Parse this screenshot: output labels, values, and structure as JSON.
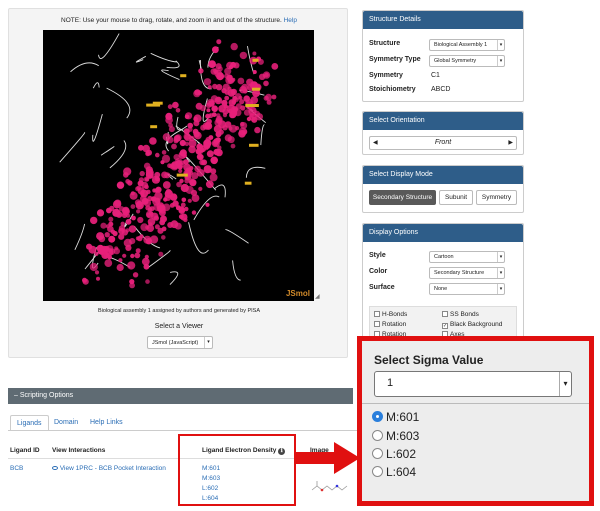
{
  "viewer": {
    "note": "NOTE: Use your mouse to drag, rotate, and zoom in and out of the structure.",
    "help_link": "Help",
    "jsmol_tag": "JSmol",
    "resize_glyph": "◢",
    "assembly_caption": "Biological assembly 1 assigned by authors and generated by PISA",
    "select_label": "Select a Viewer",
    "select_value": "JSmol (JavaScript)"
  },
  "structure_details": {
    "title": "Structure Details",
    "structure_label": "Structure",
    "structure_value": "Biological Assembly 1",
    "symmetry_type_label": "Symmetry Type",
    "symmetry_type_value": "Global Symmetry",
    "symmetry_label": "Symmetry",
    "symmetry_value": "C1",
    "stoichiometry_label": "Stoichiometry",
    "stoichiometry_value": "ABCD"
  },
  "orientation": {
    "title": "Select Orientation",
    "value": "Front",
    "prev": "◀",
    "next": "▶"
  },
  "display_mode": {
    "title": "Select Display Mode",
    "buttons": [
      "Secondary Structure",
      "Subunit",
      "Symmetry"
    ]
  },
  "display_options": {
    "title": "Display Options",
    "style_label": "Style",
    "style_value": "Cartoon",
    "color_label": "Color",
    "color_value": "Secondary Structure",
    "surface_label": "Surface",
    "surface_value": "None",
    "checkboxes": [
      {
        "label": "H-Bonds",
        "checked": false
      },
      {
        "label": "SS Bonds",
        "checked": false
      },
      {
        "label": "Rotation",
        "checked": false
      },
      {
        "label": "Black Background",
        "checked": true
      },
      {
        "label": "Rotation",
        "checked": false
      },
      {
        "label": "Axes",
        "checked": false
      }
    ]
  },
  "scripting": {
    "bar_label": "– Scripting Options",
    "tabs": [
      "Ligands",
      "Domain",
      "Help Links"
    ],
    "columns": [
      "Ligand ID",
      "View Interactions",
      "Ligand Electron Density",
      "Image"
    ],
    "info_icon": "ℹ",
    "row": {
      "ligand_id": "BCB",
      "interaction": "View 1PRC - BCB Pocket Interaction",
      "densities": [
        "M:601",
        "M:603",
        "L:602",
        "L:604"
      ]
    }
  },
  "sigma": {
    "title": "Select Sigma Value",
    "value": "1",
    "options": [
      "M:601",
      "M:603",
      "L:602",
      "L:604"
    ],
    "selected_index": 0
  },
  "colors": {
    "panel_header": "#2e5d89",
    "callout_border": "#e01010",
    "link": "#2a6db5",
    "protein_helix": "#e8207a",
    "protein_sheet": "#e0b020",
    "radio_selected": "#2a7fdc"
  },
  "icons": {
    "caret": "▾",
    "info": "info-icon",
    "arrow": "red-arrow-icon",
    "radio_selected": "radio-selected-icon",
    "radio_unselected": "radio-unselected-icon"
  }
}
